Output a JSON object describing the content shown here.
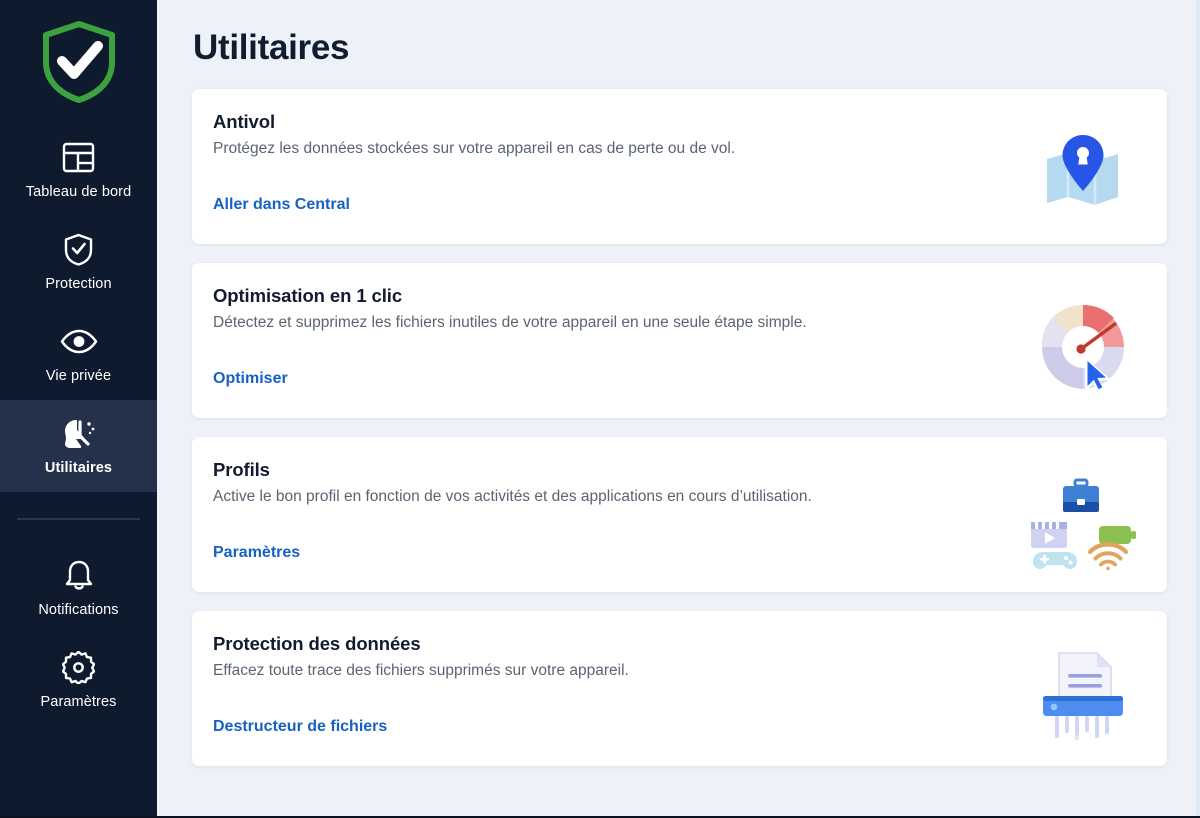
{
  "sidebar": {
    "logo_icon": "shield-check-logo",
    "items": [
      {
        "label": "Tableau de bord",
        "icon": "dashboard-icon",
        "active": false
      },
      {
        "label": "Protection",
        "icon": "shield-check-icon",
        "active": false
      },
      {
        "label": "Vie privée",
        "icon": "eye-icon",
        "active": false
      },
      {
        "label": "Utilitaires",
        "icon": "tools-broom-icon",
        "active": true
      }
    ],
    "bottom_items": [
      {
        "label": "Notifications",
        "icon": "bell-icon",
        "active": false
      },
      {
        "label": "Paramètres",
        "icon": "gear-icon",
        "active": false
      }
    ]
  },
  "main": {
    "title": "Utilitaires",
    "cards": [
      {
        "title": "Antivol",
        "description": "Protégez les données stockées sur votre appareil en cas de perte ou de vol.",
        "link": "Aller dans Central",
        "art": "map-pin-lock-icon"
      },
      {
        "title": "Optimisation en 1 clic",
        "description": "Détectez et supprimez les fichiers inutiles de votre appareil en une seule étape simple.",
        "link": "Optimiser",
        "art": "gauge-cursor-icon"
      },
      {
        "title": "Profils",
        "description": "Active le bon profil en fonction de vos activités et des applications en cours d’utilisation.",
        "link": "Paramètres",
        "art": "profiles-icons"
      },
      {
        "title": "Protection des données",
        "description": "Effacez toute trace des fichiers supprimés sur votre appareil.",
        "link": "Destructeur de fichiers",
        "art": "shredder-icon"
      }
    ]
  },
  "colors": {
    "sidebar_bg": "#0e1a2e",
    "sidebar_active_bg": "#25314a",
    "page_bg": "#eef1f8",
    "card_bg": "#ffffff",
    "link_blue": "#1761c4",
    "title_navy": "#111c2e",
    "logo_green": "#3ba23f"
  }
}
